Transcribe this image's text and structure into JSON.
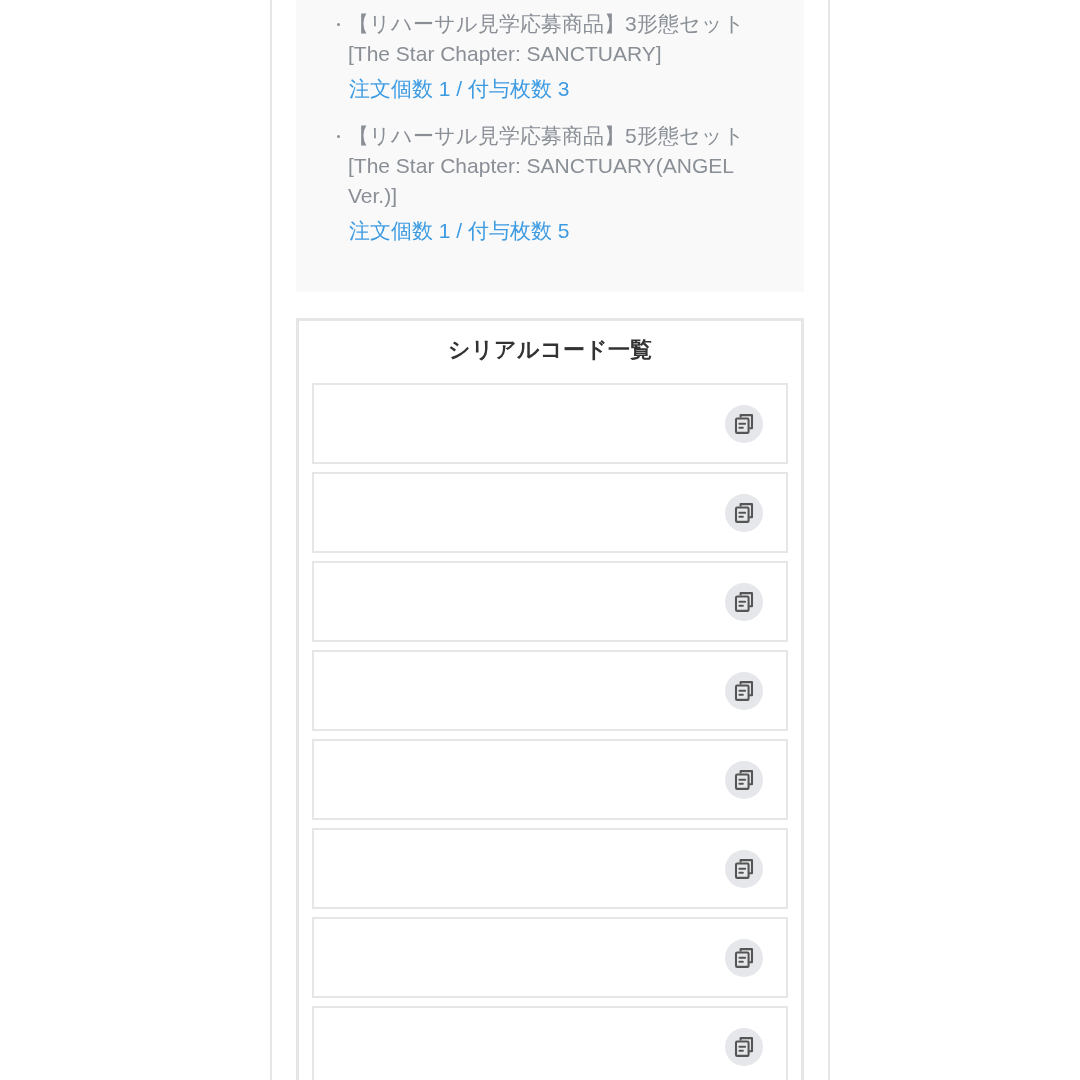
{
  "order_items": [
    {
      "title": "【リハーサル見学応募商品】3形態セット",
      "subtitle": "[The Star Chapter: SANCTUARY]",
      "count": "注文個数 1 / 付与枚数 3"
    },
    {
      "title": "【リハーサル見学応募商品】5形態セット",
      "subtitle": "[The Star Chapter: SANCTUARY(ANGEL Ver.)]",
      "count": "注文個数 1 / 付与枚数 5"
    }
  ],
  "serial_codes": {
    "title": "シリアルコード一覧",
    "rows": [
      {
        "copyable": true
      },
      {
        "copyable": true
      },
      {
        "copyable": true
      },
      {
        "copyable": true
      },
      {
        "copyable": true
      },
      {
        "copyable": true
      },
      {
        "copyable": true
      },
      {
        "copyable": true
      }
    ]
  }
}
